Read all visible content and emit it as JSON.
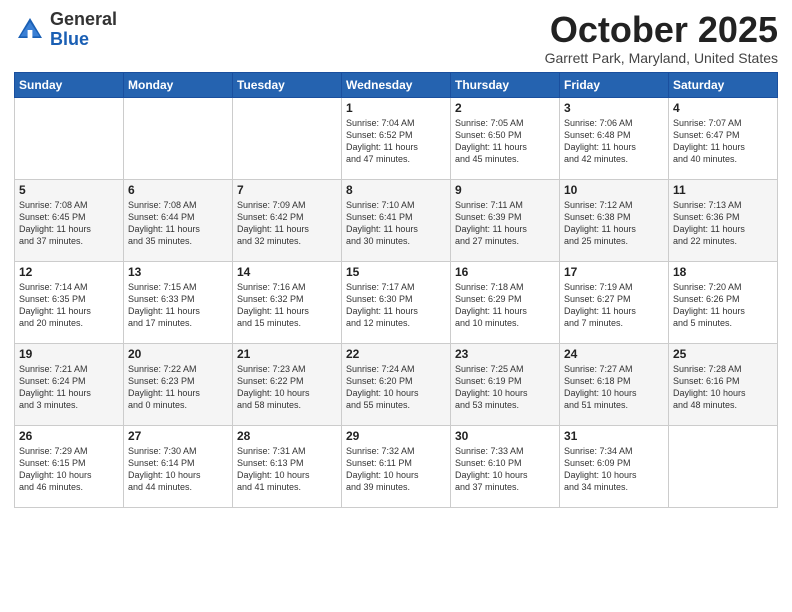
{
  "header": {
    "logo_general": "General",
    "logo_blue": "Blue",
    "month_title": "October 2025",
    "location": "Garrett Park, Maryland, United States"
  },
  "weekdays": [
    "Sunday",
    "Monday",
    "Tuesday",
    "Wednesday",
    "Thursday",
    "Friday",
    "Saturday"
  ],
  "weeks": [
    [
      {
        "day": "",
        "info": ""
      },
      {
        "day": "",
        "info": ""
      },
      {
        "day": "",
        "info": ""
      },
      {
        "day": "1",
        "info": "Sunrise: 7:04 AM\nSunset: 6:52 PM\nDaylight: 11 hours\nand 47 minutes."
      },
      {
        "day": "2",
        "info": "Sunrise: 7:05 AM\nSunset: 6:50 PM\nDaylight: 11 hours\nand 45 minutes."
      },
      {
        "day": "3",
        "info": "Sunrise: 7:06 AM\nSunset: 6:48 PM\nDaylight: 11 hours\nand 42 minutes."
      },
      {
        "day": "4",
        "info": "Sunrise: 7:07 AM\nSunset: 6:47 PM\nDaylight: 11 hours\nand 40 minutes."
      }
    ],
    [
      {
        "day": "5",
        "info": "Sunrise: 7:08 AM\nSunset: 6:45 PM\nDaylight: 11 hours\nand 37 minutes."
      },
      {
        "day": "6",
        "info": "Sunrise: 7:08 AM\nSunset: 6:44 PM\nDaylight: 11 hours\nand 35 minutes."
      },
      {
        "day": "7",
        "info": "Sunrise: 7:09 AM\nSunset: 6:42 PM\nDaylight: 11 hours\nand 32 minutes."
      },
      {
        "day": "8",
        "info": "Sunrise: 7:10 AM\nSunset: 6:41 PM\nDaylight: 11 hours\nand 30 minutes."
      },
      {
        "day": "9",
        "info": "Sunrise: 7:11 AM\nSunset: 6:39 PM\nDaylight: 11 hours\nand 27 minutes."
      },
      {
        "day": "10",
        "info": "Sunrise: 7:12 AM\nSunset: 6:38 PM\nDaylight: 11 hours\nand 25 minutes."
      },
      {
        "day": "11",
        "info": "Sunrise: 7:13 AM\nSunset: 6:36 PM\nDaylight: 11 hours\nand 22 minutes."
      }
    ],
    [
      {
        "day": "12",
        "info": "Sunrise: 7:14 AM\nSunset: 6:35 PM\nDaylight: 11 hours\nand 20 minutes."
      },
      {
        "day": "13",
        "info": "Sunrise: 7:15 AM\nSunset: 6:33 PM\nDaylight: 11 hours\nand 17 minutes."
      },
      {
        "day": "14",
        "info": "Sunrise: 7:16 AM\nSunset: 6:32 PM\nDaylight: 11 hours\nand 15 minutes."
      },
      {
        "day": "15",
        "info": "Sunrise: 7:17 AM\nSunset: 6:30 PM\nDaylight: 11 hours\nand 12 minutes."
      },
      {
        "day": "16",
        "info": "Sunrise: 7:18 AM\nSunset: 6:29 PM\nDaylight: 11 hours\nand 10 minutes."
      },
      {
        "day": "17",
        "info": "Sunrise: 7:19 AM\nSunset: 6:27 PM\nDaylight: 11 hours\nand 7 minutes."
      },
      {
        "day": "18",
        "info": "Sunrise: 7:20 AM\nSunset: 6:26 PM\nDaylight: 11 hours\nand 5 minutes."
      }
    ],
    [
      {
        "day": "19",
        "info": "Sunrise: 7:21 AM\nSunset: 6:24 PM\nDaylight: 11 hours\nand 3 minutes."
      },
      {
        "day": "20",
        "info": "Sunrise: 7:22 AM\nSunset: 6:23 PM\nDaylight: 11 hours\nand 0 minutes."
      },
      {
        "day": "21",
        "info": "Sunrise: 7:23 AM\nSunset: 6:22 PM\nDaylight: 10 hours\nand 58 minutes."
      },
      {
        "day": "22",
        "info": "Sunrise: 7:24 AM\nSunset: 6:20 PM\nDaylight: 10 hours\nand 55 minutes."
      },
      {
        "day": "23",
        "info": "Sunrise: 7:25 AM\nSunset: 6:19 PM\nDaylight: 10 hours\nand 53 minutes."
      },
      {
        "day": "24",
        "info": "Sunrise: 7:27 AM\nSunset: 6:18 PM\nDaylight: 10 hours\nand 51 minutes."
      },
      {
        "day": "25",
        "info": "Sunrise: 7:28 AM\nSunset: 6:16 PM\nDaylight: 10 hours\nand 48 minutes."
      }
    ],
    [
      {
        "day": "26",
        "info": "Sunrise: 7:29 AM\nSunset: 6:15 PM\nDaylight: 10 hours\nand 46 minutes."
      },
      {
        "day": "27",
        "info": "Sunrise: 7:30 AM\nSunset: 6:14 PM\nDaylight: 10 hours\nand 44 minutes."
      },
      {
        "day": "28",
        "info": "Sunrise: 7:31 AM\nSunset: 6:13 PM\nDaylight: 10 hours\nand 41 minutes."
      },
      {
        "day": "29",
        "info": "Sunrise: 7:32 AM\nSunset: 6:11 PM\nDaylight: 10 hours\nand 39 minutes."
      },
      {
        "day": "30",
        "info": "Sunrise: 7:33 AM\nSunset: 6:10 PM\nDaylight: 10 hours\nand 37 minutes."
      },
      {
        "day": "31",
        "info": "Sunrise: 7:34 AM\nSunset: 6:09 PM\nDaylight: 10 hours\nand 34 minutes."
      },
      {
        "day": "",
        "info": ""
      }
    ]
  ]
}
